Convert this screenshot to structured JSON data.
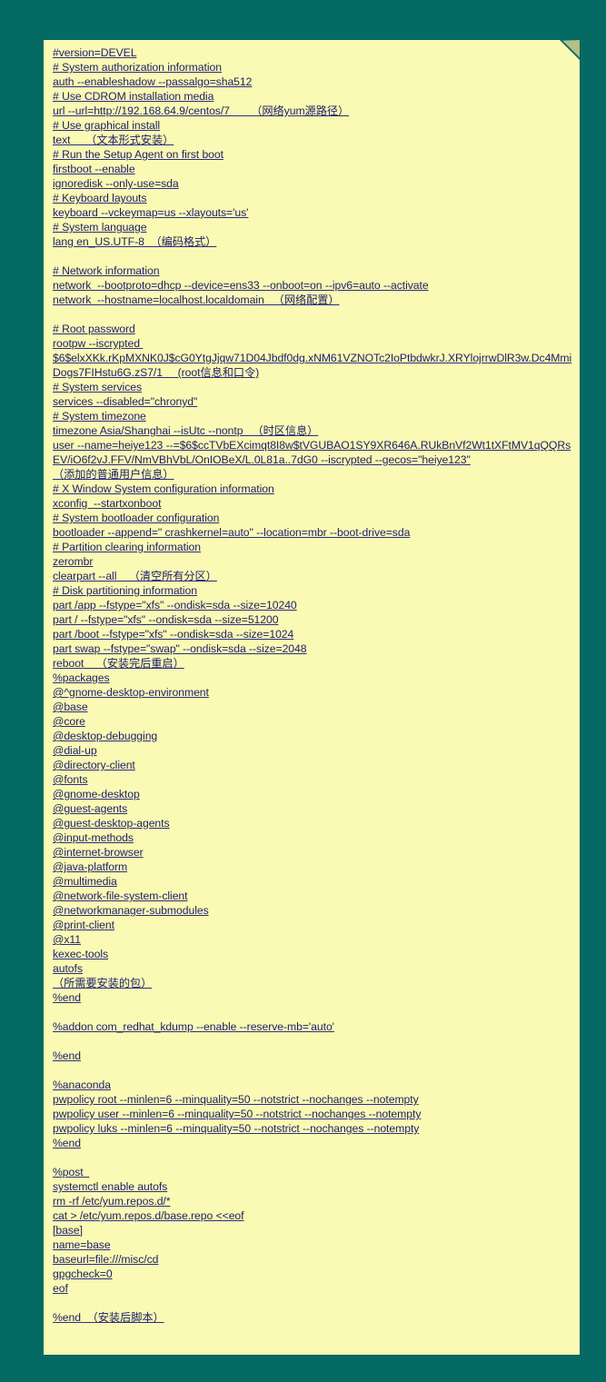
{
  "document": {
    "kind": "kickstart-config-note",
    "background_color": "#046A63",
    "page_color": "#FAFAB4",
    "text_color": "#1D1D6B",
    "lines": [
      "#version=DEVEL",
      "# System authorization information",
      "auth --enableshadow --passalgo=sha512",
      "# Use CDROM installation media",
      "url --url=http://192.168.64.9/centos/7       （网络yum源路径）",
      "# Use graphical install",
      "text     （文本形式安装）",
      "# Run the Setup Agent on first boot",
      "firstboot --enable",
      "ignoredisk --only-use=sda",
      "# Keyboard layouts",
      "keyboard --vckeymap=us --xlayouts='us'",
      "# System language",
      "lang en_US.UTF-8  （编码格式）",
      "",
      "# Network information",
      "network  --bootproto=dhcp --device=ens33 --onboot=on --ipv6=auto --activate",
      "network  --hostname=localhost.localdomain   （网络配置）",
      "",
      "# Root password",
      "rootpw --iscrypted ",
      "$6$elxXKk.rKpMXNK0J$cG0YtgJjqw71D04Jbdf0dg.xNM61VZNOTc2IoPtbdwkrJ.XRYlojrrwDlR3w.Dc4MmiDogs7FIHstu6G.zS7/1     (root信息和口令)",
      "# System services",
      "services --disabled=\"chronyd\"",
      "# System timezone",
      "timezone Asia/Shanghai --isUtc --nontp   （时区信息）",
      "user --name=heiye123 --=$6$ccTVbEXcimqt8I8w$tVGUBAO1SY9XR646A.RUkBnVf2Wt1tXFtMV1qQQRsEV/iO6f2vJ.FFV/NmVBhVbL/OnIOBeX/L.0L81a..7dG0 --iscrypted --gecos=\"heiye123\"",
      "（添加的普通用户信息）",
      "# X Window System configuration information",
      "xconfig  --startxonboot",
      "# System bootloader configuration",
      "bootloader --append=\" crashkernel=auto\" --location=mbr --boot-drive=sda",
      "# Partition clearing information",
      "zerombr",
      "clearpart --all    （清空所有分区）",
      "# Disk partitioning information",
      "part /app --fstype=\"xfs\" --ondisk=sda --size=10240",
      "part / --fstype=\"xfs\" --ondisk=sda --size=51200",
      "part /boot --fstype=\"xfs\" --ondisk=sda --size=1024",
      "part swap --fstype=\"swap\" --ondisk=sda --size=2048",
      "reboot    （安装完后重启）",
      "%packages",
      "@^gnome-desktop-environment",
      "@base",
      "@core",
      "@desktop-debugging",
      "@dial-up",
      "@directory-client",
      "@fonts",
      "@gnome-desktop",
      "@guest-agents",
      "@guest-desktop-agents",
      "@input-methods",
      "@internet-browser",
      "@java-platform",
      "@multimedia",
      "@network-file-system-client",
      "@networkmanager-submodules",
      "@print-client",
      "@x11",
      "kexec-tools",
      "autofs",
      "（所需要安装的包）",
      "%end",
      "",
      "%addon com_redhat_kdump --enable --reserve-mb='auto'",
      "",
      "%end",
      "",
      "%anaconda",
      "pwpolicy root --minlen=6 --minquality=50 --notstrict --nochanges --notempty",
      "pwpolicy user --minlen=6 --minquality=50 --notstrict --nochanges --notempty",
      "pwpolicy luks --minlen=6 --minquality=50 --notstrict --nochanges --notempty",
      "%end",
      "",
      "%post  ",
      "systemctl enable autofs",
      "rm -rf /etc/yum.repos.d/*",
      "cat > /etc/yum.repos.d/base.repo <<eof",
      "[base]",
      "name=base",
      "baseurl=file:///misc/cd",
      "gpgcheck=0",
      "eof",
      "",
      "%end  （安装后脚本）"
    ]
  }
}
